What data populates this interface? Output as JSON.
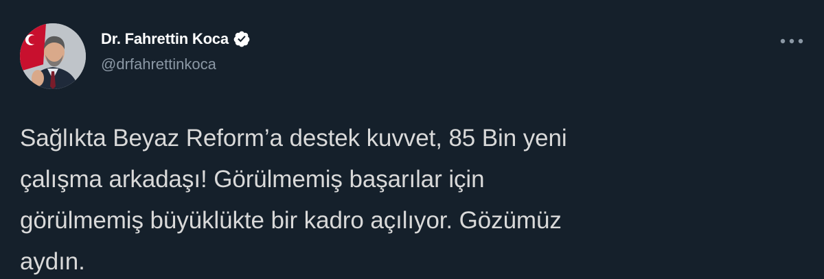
{
  "author": {
    "display_name": "Dr. Fahrettin Koca",
    "handle": "@drfahrettinkoca",
    "verified": true
  },
  "tweet": {
    "text": "Sağlıkta Beyaz Reform’a destek kuvvet, 85 Bin yeni\nçalışma arkadaşı! Görülmemiş başarılar için\ngörülmemiş büyüklükte bir kadro açılıyor. Gözümüz\naydın."
  },
  "icons": {
    "verified": "verified-badge-icon",
    "more": "more-options-icon"
  },
  "colors": {
    "background": "#15202b",
    "text": "#d9d9d9",
    "handle": "#8b98a5",
    "name": "#ffffff"
  }
}
